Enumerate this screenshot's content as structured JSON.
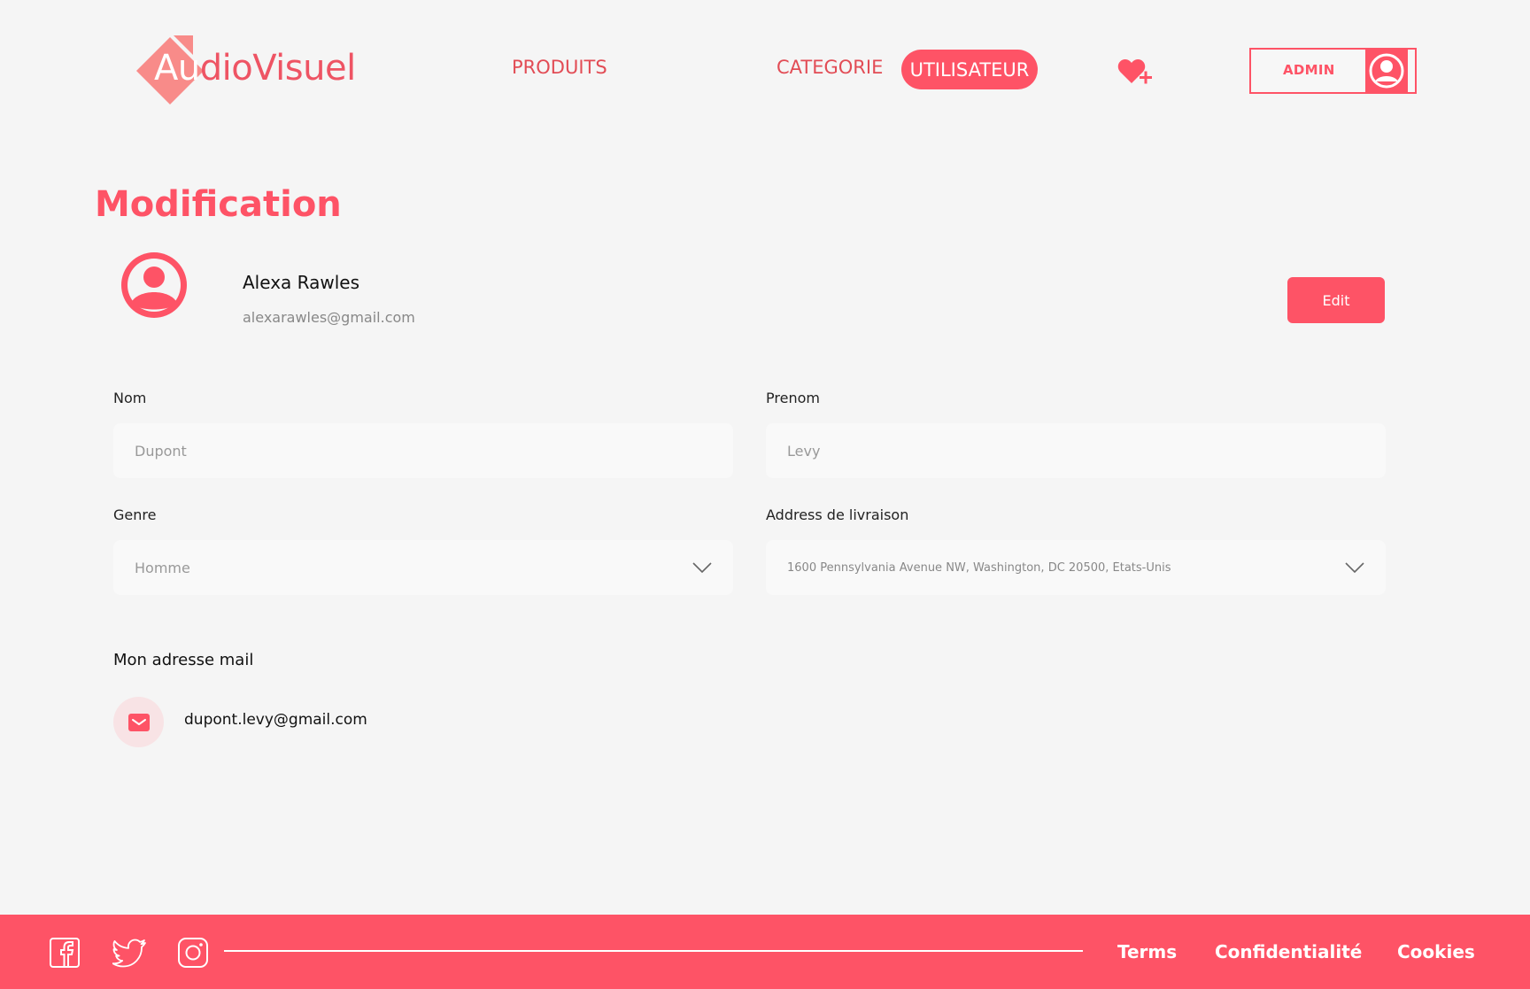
{
  "header": {
    "logo_first": "Au",
    "logo_rest": "dioVisuel",
    "nav": {
      "produits": "PRODUITS",
      "categorie": "CATEGORIE",
      "utilisateur": "UTILISATEUR"
    },
    "admin_label": "ADMIN",
    "icons": {
      "wishlist": "heart-plus-icon",
      "avatar": "user-circle-icon"
    }
  },
  "page": {
    "title": "Modification"
  },
  "profile": {
    "name": "Alexa Rawles",
    "email": "alexarawles@gmail.com",
    "edit_label": "Edit"
  },
  "form": {
    "nom": {
      "label": "Nom",
      "placeholder": "Dupont"
    },
    "prenom": {
      "label": "Prenom",
      "placeholder": "Levy"
    },
    "genre": {
      "label": "Genre",
      "value": "Homme"
    },
    "address": {
      "label": "Address de livraison",
      "value": "1600 Pennsylvania Avenue NW, Washington, DC 20500, États-Unis"
    }
  },
  "mail": {
    "title": "Mon adresse mail",
    "value": "dupont.levy@gmail.com",
    "icon": "envelope-icon"
  },
  "footer": {
    "social": [
      "facebook-icon",
      "twitter-icon",
      "instagram-icon"
    ],
    "links": {
      "terms": "Terms",
      "privacy": "Confidentialité",
      "cookies": "Cookies"
    }
  },
  "colors": {
    "accent": "#fe5366",
    "nav_text": "#e24c55",
    "background": "#f5f5f5",
    "field_bg": "#f9f9f9",
    "logo_mark": "#f88b89"
  }
}
